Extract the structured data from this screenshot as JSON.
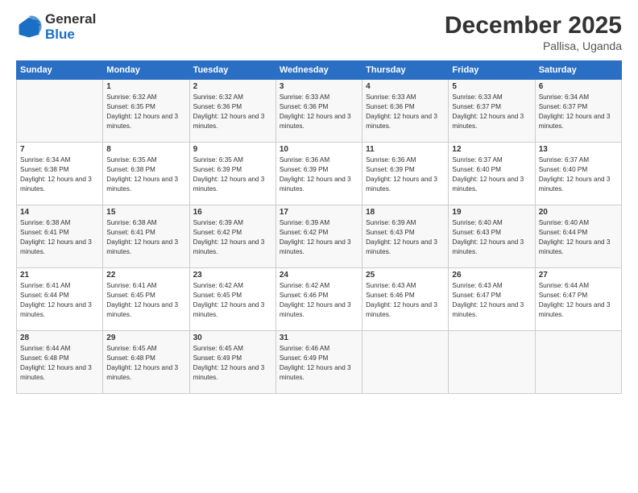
{
  "header": {
    "logo_general": "General",
    "logo_blue": "Blue",
    "month_year": "December 2025",
    "location": "Pallisa, Uganda"
  },
  "columns": [
    "Sunday",
    "Monday",
    "Tuesday",
    "Wednesday",
    "Thursday",
    "Friday",
    "Saturday"
  ],
  "weeks": [
    [
      {
        "day": "",
        "sunrise": "",
        "sunset": "",
        "daylight": ""
      },
      {
        "day": "1",
        "sunrise": "Sunrise: 6:32 AM",
        "sunset": "Sunset: 6:35 PM",
        "daylight": "Daylight: 12 hours and 3 minutes."
      },
      {
        "day": "2",
        "sunrise": "Sunrise: 6:32 AM",
        "sunset": "Sunset: 6:36 PM",
        "daylight": "Daylight: 12 hours and 3 minutes."
      },
      {
        "day": "3",
        "sunrise": "Sunrise: 6:33 AM",
        "sunset": "Sunset: 6:36 PM",
        "daylight": "Daylight: 12 hours and 3 minutes."
      },
      {
        "day": "4",
        "sunrise": "Sunrise: 6:33 AM",
        "sunset": "Sunset: 6:36 PM",
        "daylight": "Daylight: 12 hours and 3 minutes."
      },
      {
        "day": "5",
        "sunrise": "Sunrise: 6:33 AM",
        "sunset": "Sunset: 6:37 PM",
        "daylight": "Daylight: 12 hours and 3 minutes."
      },
      {
        "day": "6",
        "sunrise": "Sunrise: 6:34 AM",
        "sunset": "Sunset: 6:37 PM",
        "daylight": "Daylight: 12 hours and 3 minutes."
      }
    ],
    [
      {
        "day": "7",
        "sunrise": "Sunrise: 6:34 AM",
        "sunset": "Sunset: 6:38 PM",
        "daylight": "Daylight: 12 hours and 3 minutes."
      },
      {
        "day": "8",
        "sunrise": "Sunrise: 6:35 AM",
        "sunset": "Sunset: 6:38 PM",
        "daylight": "Daylight: 12 hours and 3 minutes."
      },
      {
        "day": "9",
        "sunrise": "Sunrise: 6:35 AM",
        "sunset": "Sunset: 6:39 PM",
        "daylight": "Daylight: 12 hours and 3 minutes."
      },
      {
        "day": "10",
        "sunrise": "Sunrise: 6:36 AM",
        "sunset": "Sunset: 6:39 PM",
        "daylight": "Daylight: 12 hours and 3 minutes."
      },
      {
        "day": "11",
        "sunrise": "Sunrise: 6:36 AM",
        "sunset": "Sunset: 6:39 PM",
        "daylight": "Daylight: 12 hours and 3 minutes."
      },
      {
        "day": "12",
        "sunrise": "Sunrise: 6:37 AM",
        "sunset": "Sunset: 6:40 PM",
        "daylight": "Daylight: 12 hours and 3 minutes."
      },
      {
        "day": "13",
        "sunrise": "Sunrise: 6:37 AM",
        "sunset": "Sunset: 6:40 PM",
        "daylight": "Daylight: 12 hours and 3 minutes."
      }
    ],
    [
      {
        "day": "14",
        "sunrise": "Sunrise: 6:38 AM",
        "sunset": "Sunset: 6:41 PM",
        "daylight": "Daylight: 12 hours and 3 minutes."
      },
      {
        "day": "15",
        "sunrise": "Sunrise: 6:38 AM",
        "sunset": "Sunset: 6:41 PM",
        "daylight": "Daylight: 12 hours and 3 minutes."
      },
      {
        "day": "16",
        "sunrise": "Sunrise: 6:39 AM",
        "sunset": "Sunset: 6:42 PM",
        "daylight": "Daylight: 12 hours and 3 minutes."
      },
      {
        "day": "17",
        "sunrise": "Sunrise: 6:39 AM",
        "sunset": "Sunset: 6:42 PM",
        "daylight": "Daylight: 12 hours and 3 minutes."
      },
      {
        "day": "18",
        "sunrise": "Sunrise: 6:39 AM",
        "sunset": "Sunset: 6:43 PM",
        "daylight": "Daylight: 12 hours and 3 minutes."
      },
      {
        "day": "19",
        "sunrise": "Sunrise: 6:40 AM",
        "sunset": "Sunset: 6:43 PM",
        "daylight": "Daylight: 12 hours and 3 minutes."
      },
      {
        "day": "20",
        "sunrise": "Sunrise: 6:40 AM",
        "sunset": "Sunset: 6:44 PM",
        "daylight": "Daylight: 12 hours and 3 minutes."
      }
    ],
    [
      {
        "day": "21",
        "sunrise": "Sunrise: 6:41 AM",
        "sunset": "Sunset: 6:44 PM",
        "daylight": "Daylight: 12 hours and 3 minutes."
      },
      {
        "day": "22",
        "sunrise": "Sunrise: 6:41 AM",
        "sunset": "Sunset: 6:45 PM",
        "daylight": "Daylight: 12 hours and 3 minutes."
      },
      {
        "day": "23",
        "sunrise": "Sunrise: 6:42 AM",
        "sunset": "Sunset: 6:45 PM",
        "daylight": "Daylight: 12 hours and 3 minutes."
      },
      {
        "day": "24",
        "sunrise": "Sunrise: 6:42 AM",
        "sunset": "Sunset: 6:46 PM",
        "daylight": "Daylight: 12 hours and 3 minutes."
      },
      {
        "day": "25",
        "sunrise": "Sunrise: 6:43 AM",
        "sunset": "Sunset: 6:46 PM",
        "daylight": "Daylight: 12 hours and 3 minutes."
      },
      {
        "day": "26",
        "sunrise": "Sunrise: 6:43 AM",
        "sunset": "Sunset: 6:47 PM",
        "daylight": "Daylight: 12 hours and 3 minutes."
      },
      {
        "day": "27",
        "sunrise": "Sunrise: 6:44 AM",
        "sunset": "Sunset: 6:47 PM",
        "daylight": "Daylight: 12 hours and 3 minutes."
      }
    ],
    [
      {
        "day": "28",
        "sunrise": "Sunrise: 6:44 AM",
        "sunset": "Sunset: 6:48 PM",
        "daylight": "Daylight: 12 hours and 3 minutes."
      },
      {
        "day": "29",
        "sunrise": "Sunrise: 6:45 AM",
        "sunset": "Sunset: 6:48 PM",
        "daylight": "Daylight: 12 hours and 3 minutes."
      },
      {
        "day": "30",
        "sunrise": "Sunrise: 6:45 AM",
        "sunset": "Sunset: 6:49 PM",
        "daylight": "Daylight: 12 hours and 3 minutes."
      },
      {
        "day": "31",
        "sunrise": "Sunrise: 6:46 AM",
        "sunset": "Sunset: 6:49 PM",
        "daylight": "Daylight: 12 hours and 3 minutes."
      },
      {
        "day": "",
        "sunrise": "",
        "sunset": "",
        "daylight": ""
      },
      {
        "day": "",
        "sunrise": "",
        "sunset": "",
        "daylight": ""
      },
      {
        "day": "",
        "sunrise": "",
        "sunset": "",
        "daylight": ""
      }
    ]
  ]
}
